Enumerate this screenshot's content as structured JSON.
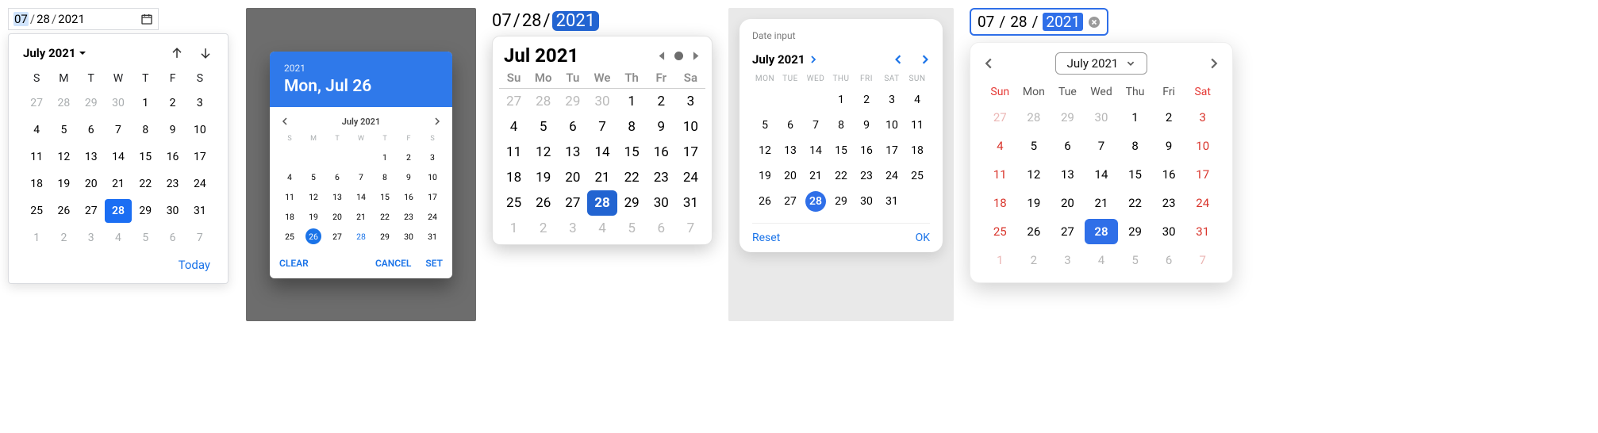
{
  "weekdays_short": [
    "S",
    "M",
    "T",
    "W",
    "T",
    "F",
    "S"
  ],
  "weekdays_2": [
    "Su",
    "Mo",
    "Tu",
    "We",
    "Th",
    "Fr",
    "Sa"
  ],
  "weekdays_3u": [
    "MON",
    "TUE",
    "WED",
    "THU",
    "FRI",
    "SAT",
    "SUN"
  ],
  "weekdays_3": [
    "Sun",
    "Mon",
    "Tue",
    "Wed",
    "Thu",
    "Fri",
    "Sat"
  ],
  "p1": {
    "input": {
      "mm": "07",
      "dd": "28",
      "yy": "2021",
      "sep": "/"
    },
    "title": "July 2021",
    "today": "Today",
    "days": [
      {
        "n": "27",
        "out": true
      },
      {
        "n": "28",
        "out": true
      },
      {
        "n": "29",
        "out": true
      },
      {
        "n": "30",
        "out": true
      },
      {
        "n": "1"
      },
      {
        "n": "2"
      },
      {
        "n": "3"
      },
      {
        "n": "4"
      },
      {
        "n": "5"
      },
      {
        "n": "6"
      },
      {
        "n": "7"
      },
      {
        "n": "8"
      },
      {
        "n": "9"
      },
      {
        "n": "10"
      },
      {
        "n": "11"
      },
      {
        "n": "12"
      },
      {
        "n": "13"
      },
      {
        "n": "14"
      },
      {
        "n": "15"
      },
      {
        "n": "16"
      },
      {
        "n": "17"
      },
      {
        "n": "18"
      },
      {
        "n": "19"
      },
      {
        "n": "20"
      },
      {
        "n": "21"
      },
      {
        "n": "22"
      },
      {
        "n": "23"
      },
      {
        "n": "24"
      },
      {
        "n": "25"
      },
      {
        "n": "26"
      },
      {
        "n": "27"
      },
      {
        "n": "28",
        "sel": true
      },
      {
        "n": "29"
      },
      {
        "n": "30"
      },
      {
        "n": "31"
      },
      {
        "n": "1",
        "out": true
      },
      {
        "n": "2",
        "out": true
      },
      {
        "n": "3",
        "out": true
      },
      {
        "n": "4",
        "out": true
      },
      {
        "n": "5",
        "out": true
      },
      {
        "n": "6",
        "out": true
      },
      {
        "n": "7",
        "out": true
      }
    ]
  },
  "p2": {
    "year": "2021",
    "date_long": "Mon, Jul 26",
    "month": "July 2021",
    "actions": {
      "clear": "CLEAR",
      "cancel": "CANCEL",
      "set": "SET"
    },
    "days": [
      {
        "n": ""
      },
      {
        "n": ""
      },
      {
        "n": ""
      },
      {
        "n": ""
      },
      {
        "n": "1"
      },
      {
        "n": "2"
      },
      {
        "n": "3"
      },
      {
        "n": "4"
      },
      {
        "n": "5"
      },
      {
        "n": "6"
      },
      {
        "n": "7"
      },
      {
        "n": "8"
      },
      {
        "n": "9"
      },
      {
        "n": "10"
      },
      {
        "n": "11"
      },
      {
        "n": "12"
      },
      {
        "n": "13"
      },
      {
        "n": "14"
      },
      {
        "n": "15"
      },
      {
        "n": "16"
      },
      {
        "n": "17"
      },
      {
        "n": "18"
      },
      {
        "n": "19"
      },
      {
        "n": "20"
      },
      {
        "n": "21"
      },
      {
        "n": "22"
      },
      {
        "n": "23"
      },
      {
        "n": "24"
      },
      {
        "n": "25"
      },
      {
        "n": "26",
        "sel": true
      },
      {
        "n": "27"
      },
      {
        "n": "28",
        "today": true
      },
      {
        "n": "29"
      },
      {
        "n": "30"
      },
      {
        "n": "31"
      }
    ]
  },
  "p3": {
    "input": {
      "mm": "07",
      "dd": "28",
      "yy": "2021",
      "sep": "/"
    },
    "title": "Jul 2021",
    "days": [
      {
        "n": "27",
        "out": true
      },
      {
        "n": "28",
        "out": true
      },
      {
        "n": "29",
        "out": true
      },
      {
        "n": "30",
        "out": true
      },
      {
        "n": "1"
      },
      {
        "n": "2"
      },
      {
        "n": "3"
      },
      {
        "n": "4"
      },
      {
        "n": "5"
      },
      {
        "n": "6"
      },
      {
        "n": "7"
      },
      {
        "n": "8"
      },
      {
        "n": "9"
      },
      {
        "n": "10"
      },
      {
        "n": "11"
      },
      {
        "n": "12"
      },
      {
        "n": "13"
      },
      {
        "n": "14"
      },
      {
        "n": "15"
      },
      {
        "n": "16"
      },
      {
        "n": "17"
      },
      {
        "n": "18"
      },
      {
        "n": "19"
      },
      {
        "n": "20"
      },
      {
        "n": "21"
      },
      {
        "n": "22"
      },
      {
        "n": "23"
      },
      {
        "n": "24"
      },
      {
        "n": "25"
      },
      {
        "n": "26"
      },
      {
        "n": "27"
      },
      {
        "n": "28",
        "sel": true
      },
      {
        "n": "29"
      },
      {
        "n": "30"
      },
      {
        "n": "31"
      },
      {
        "n": "1",
        "out": true
      },
      {
        "n": "2",
        "out": true
      },
      {
        "n": "3",
        "out": true
      },
      {
        "n": "4",
        "out": true
      },
      {
        "n": "5",
        "out": true
      },
      {
        "n": "6",
        "out": true
      },
      {
        "n": "7",
        "out": true
      }
    ]
  },
  "p4": {
    "label": "Date input",
    "title": "July 2021",
    "reset": "Reset",
    "ok": "OK",
    "days": [
      {
        "n": ""
      },
      {
        "n": ""
      },
      {
        "n": ""
      },
      {
        "n": "1"
      },
      {
        "n": "2"
      },
      {
        "n": "3"
      },
      {
        "n": "4"
      },
      {
        "n": "5"
      },
      {
        "n": "6"
      },
      {
        "n": "7"
      },
      {
        "n": "8"
      },
      {
        "n": "9"
      },
      {
        "n": "10"
      },
      {
        "n": "11"
      },
      {
        "n": "12"
      },
      {
        "n": "13"
      },
      {
        "n": "14"
      },
      {
        "n": "15"
      },
      {
        "n": "16"
      },
      {
        "n": "17"
      },
      {
        "n": "18"
      },
      {
        "n": "19"
      },
      {
        "n": "20"
      },
      {
        "n": "21"
      },
      {
        "n": "22"
      },
      {
        "n": "23"
      },
      {
        "n": "24"
      },
      {
        "n": "25"
      },
      {
        "n": "26"
      },
      {
        "n": "27"
      },
      {
        "n": "28",
        "sel": true
      },
      {
        "n": "29"
      },
      {
        "n": "30"
      },
      {
        "n": "31"
      },
      {
        "n": ""
      }
    ]
  },
  "p5": {
    "input": {
      "mm": "07",
      "dd": "28",
      "yy": "2021",
      "sep": "/"
    },
    "title": "July 2021",
    "days": [
      {
        "n": "27",
        "out": true,
        "red": true
      },
      {
        "n": "28",
        "out": true
      },
      {
        "n": "29",
        "out": true
      },
      {
        "n": "30",
        "out": true
      },
      {
        "n": "1"
      },
      {
        "n": "2"
      },
      {
        "n": "3",
        "red": true
      },
      {
        "n": "4",
        "red": true
      },
      {
        "n": "5"
      },
      {
        "n": "6"
      },
      {
        "n": "7"
      },
      {
        "n": "8"
      },
      {
        "n": "9"
      },
      {
        "n": "10",
        "red": true
      },
      {
        "n": "11",
        "red": true
      },
      {
        "n": "12"
      },
      {
        "n": "13"
      },
      {
        "n": "14"
      },
      {
        "n": "15"
      },
      {
        "n": "16"
      },
      {
        "n": "17",
        "red": true
      },
      {
        "n": "18",
        "red": true
      },
      {
        "n": "19"
      },
      {
        "n": "20"
      },
      {
        "n": "21"
      },
      {
        "n": "22"
      },
      {
        "n": "23"
      },
      {
        "n": "24",
        "red": true
      },
      {
        "n": "25",
        "red": true
      },
      {
        "n": "26"
      },
      {
        "n": "27"
      },
      {
        "n": "28",
        "sel": true
      },
      {
        "n": "29"
      },
      {
        "n": "30"
      },
      {
        "n": "31",
        "red": true
      },
      {
        "n": "1",
        "out": true,
        "red": true
      },
      {
        "n": "2",
        "out": true
      },
      {
        "n": "3",
        "out": true
      },
      {
        "n": "4",
        "out": true
      },
      {
        "n": "5",
        "out": true
      },
      {
        "n": "6",
        "out": true
      },
      {
        "n": "7",
        "out": true,
        "red": true
      }
    ]
  }
}
